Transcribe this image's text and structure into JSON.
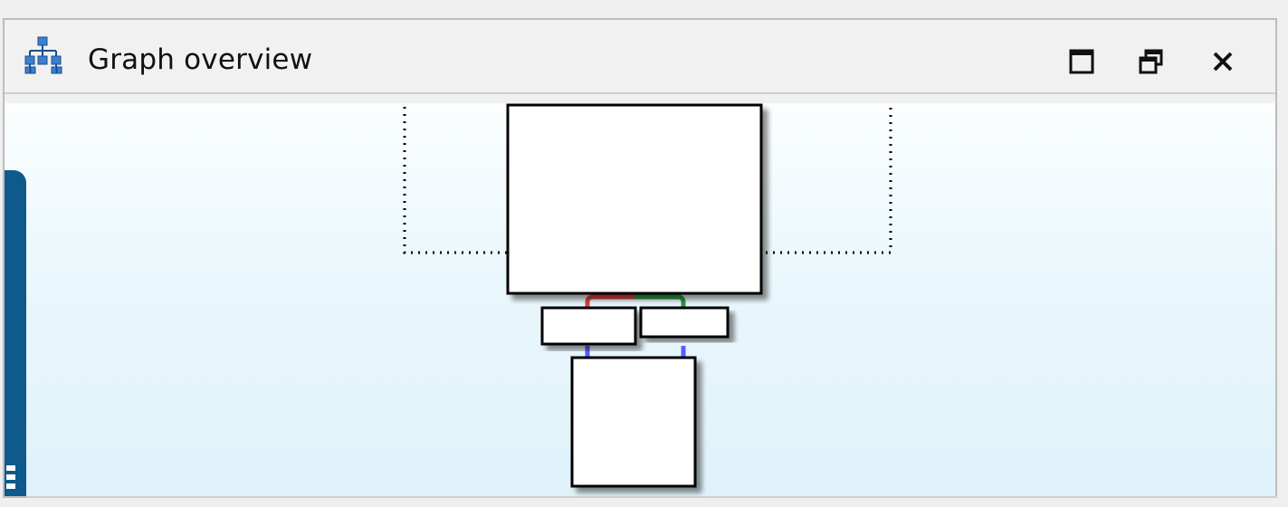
{
  "panel": {
    "title": "Graph overview",
    "title_icon": "hierarchy-icon",
    "buttons": {
      "maximize": "maximize-icon",
      "restore": "restore-icon",
      "close": "close-icon"
    }
  },
  "graph": {
    "edge_colors": {
      "red": "#e04040",
      "green": "#2e9a3e",
      "blue": "#4a4aff"
    },
    "node_fill": "#ffffff",
    "node_stroke": "#000000"
  },
  "colors": {
    "left_panel_accent": "#0e5a8c",
    "canvas_top": "#fbfeff",
    "canvas_bottom": "#dff2fa"
  }
}
